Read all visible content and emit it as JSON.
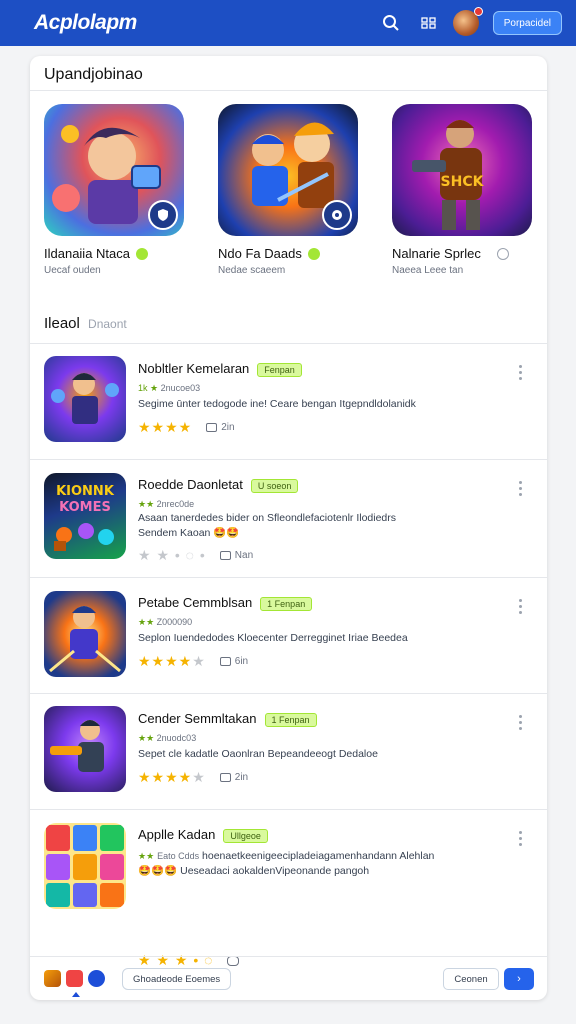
{
  "header": {
    "brand": "Acplolapm",
    "action_label": "Porpacidel",
    "notification": ""
  },
  "card": {
    "title": "Upandjobinao"
  },
  "featured": [
    {
      "name": "Ildanaiia Ntaca",
      "subtitle": "Uecaf ouden",
      "badge": "check"
    },
    {
      "name": "Ndo Fa Daads",
      "subtitle": "Nedae scaeem",
      "badge": "check"
    },
    {
      "name": "Nalnarie Sprlec",
      "subtitle": "Naeea Leee tan",
      "badge": "info"
    }
  ],
  "section": {
    "title": "Ileaol",
    "subtitle": "Dnaont"
  },
  "apps": [
    {
      "name": "Nobltler Kemelaran",
      "tag": "Fenpan",
      "meta_prefix": "1k ★",
      "meta": "2nucoe03",
      "desc": "Segime ūnter tedogode ine! Ceare bengan Itgepndldolanidk",
      "stars": 4,
      "count": "2in",
      "star_text": "★★★★"
    },
    {
      "name": "Roedde Daonletat",
      "tag": "U soeon",
      "meta_prefix": "★★",
      "meta": "2nrec0de",
      "desc": "Asaan tanerdedes bider on Sfleondlefaciotenlr Ilodiedrs Sendem Kaoan 🤩🤩",
      "stars": 0,
      "count": "Nan",
      "star_text": "★ ★ • ◌ •"
    },
    {
      "name": "Petabe Cemmblsan",
      "tag": "1 Fenpan",
      "meta_prefix": "★★",
      "meta": "Z000090",
      "desc": "Seplon Iuendedodes Kloecenter Derregginet Iriae Beedea",
      "stars": 4,
      "count": "6in",
      "star_text": "★★★★"
    },
    {
      "name": "Cender Semmltakan",
      "tag": "1 Fenpan",
      "meta_prefix": "★★",
      "meta": "2nuodc03",
      "desc": "Sepet cle kadatle Oaonlran Bepeandeeogt Dedaloe",
      "stars": 4,
      "count": "2in",
      "star_text": "★★★★"
    },
    {
      "name": "Applle Kadan",
      "tag": "Ullgeoe",
      "meta_prefix": "★★",
      "meta": "Eato Cdds",
      "desc": "hoenaetkeenigeecipladeiagamenhandann Alehlan 🤩🤩🤩 Ueseadaci aokaldenVipeonande pangoh",
      "stars": 0,
      "count": "",
      "star_text": "★ ★ ★ • ◌"
    }
  ],
  "footer": {
    "pill_label": "Ghoadeode Eoemes",
    "cancel_label": "Ceonen",
    "go_label": "›"
  }
}
